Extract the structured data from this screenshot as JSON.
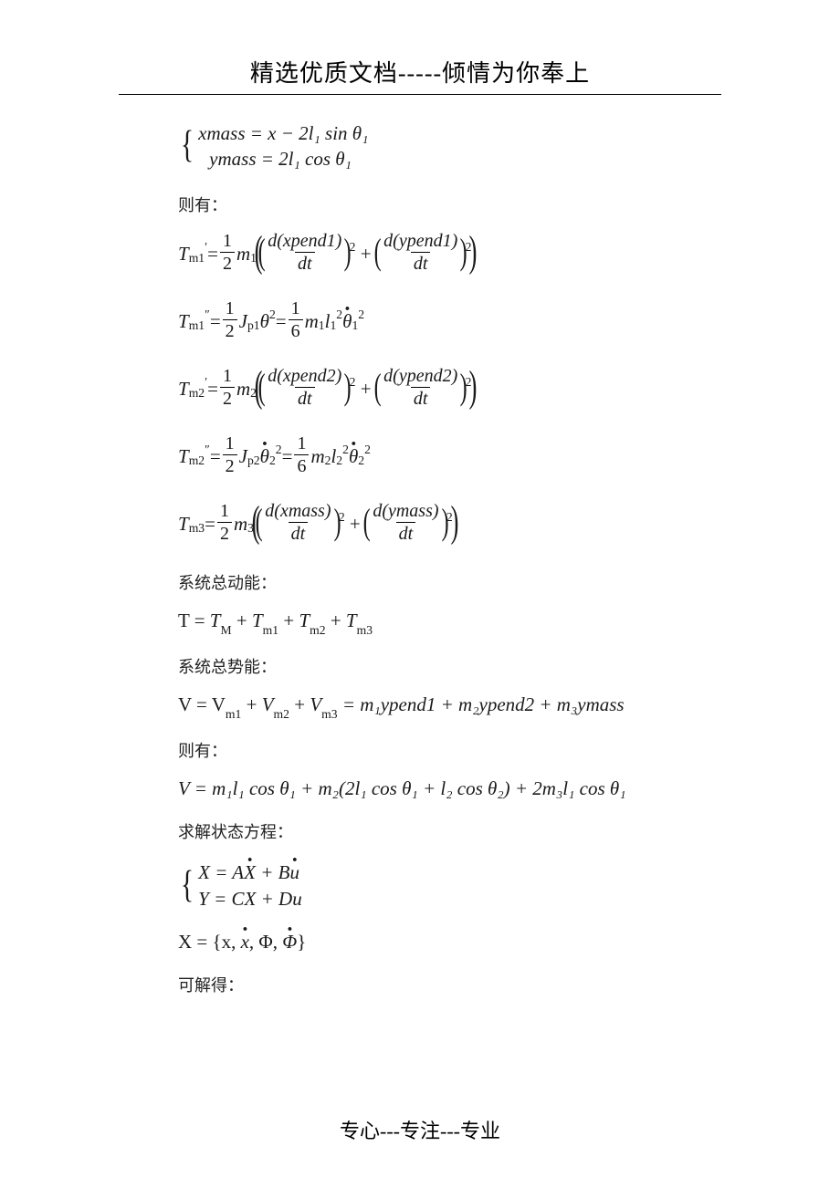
{
  "header": {
    "title": "精选优质文档-----倾情为你奉上"
  },
  "footer": {
    "text": "专心---专注---专业"
  },
  "eqs": {
    "sys1a": "xmass = x − 2l₁ sin θ₁",
    "sys1b": "ymass = 2l₁ cos θ₁",
    "label_then": "则有：",
    "Tm1p_lhs": "T",
    "Tm1p_sub": "m1",
    "Tm1p_prime": "′",
    "half_num": "1",
    "half_den": "2",
    "m1": "m",
    "idx1": "1",
    "dxpend1": "d(xpend1)",
    "dypend1": "d(ypend1)",
    "dt": "dt",
    "sq": "2",
    "Tm1pp_sub": "m1",
    "Tm1pp_mark": "″",
    "Jp1": "J",
    "p1sub": "p1",
    "theta": "θ",
    "sixth_num": "1",
    "sixth_den": "6",
    "l": "l",
    "Tm2p_sub": "m2",
    "idx2": "2",
    "dxpend2": "d(xpend2)",
    "dypend2": "d(ypend2)",
    "Jp2sub": "p2",
    "Tm3_sub": "m3",
    "idx3": "3",
    "dxmass": "d(xmass)",
    "dymass": "d(ymass)",
    "label_ke": "系统总动能：",
    "T_total_lhs": "T = ",
    "T_total_terms": [
      "T",
      "T",
      "T",
      "T"
    ],
    "T_total_subs": [
      "M",
      "m1",
      "m2",
      "m3"
    ],
    "label_pe": "系统总势能：",
    "V_line1": "V = V",
    "V_subs": [
      "m1",
      "m2",
      "m3"
    ],
    "V_rhs": " = m₁ypend1 + m₂ypend2 + m₃ymass",
    "label_then2": "则有：",
    "V_line2": "V = m₁l₁ cos θ₁ + m₂(2l₁ cos θ₁ + l₂ cos θ₂) + 2m₃l₁ cos θ₁",
    "label_state": "求解状态方程：",
    "sys2a_pre": "X = A",
    "sys2a_mid": "X",
    "sys2a_post": " + B",
    "sys2a_u": "u",
    "sys2b": "Y = CX + Du",
    "X_def_pre": "X = {x, ",
    "X_def_xdot": "x",
    "X_def_mid": ", Φ, ",
    "X_def_phidot": "Φ",
    "X_def_post": "}",
    "label_solve": "可解得："
  }
}
